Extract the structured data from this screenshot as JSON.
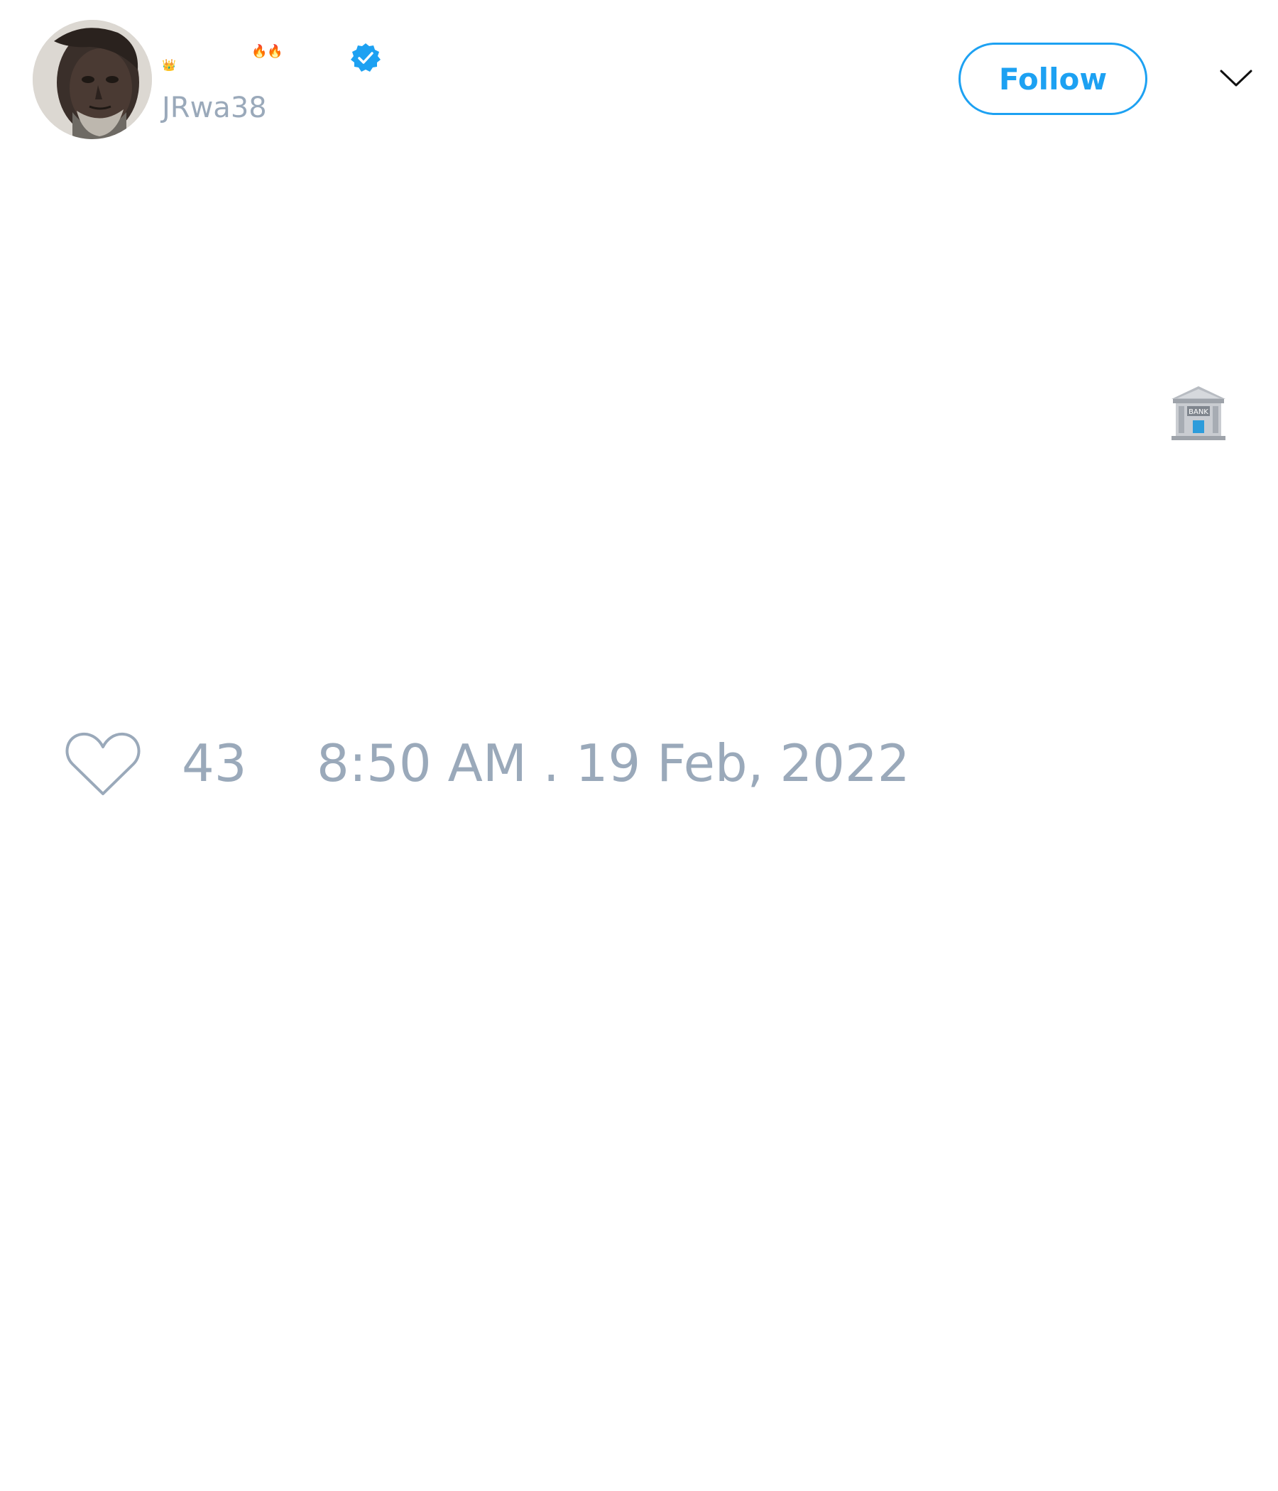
{
  "author": {
    "display_name_emojis": {
      "crown": "👑",
      "fire": "🔥🔥"
    },
    "handle": "JRwa38",
    "verified_icon": "verified-badge-icon",
    "avatar_icon": "avatar-portrait"
  },
  "actions": {
    "follow_label": "Follow",
    "menu_icon": "chevron-down-icon"
  },
  "tweet": {
    "body_emoji_icon": "bank-building-icon"
  },
  "footer": {
    "like_icon": "heart-outline-icon",
    "like_count": "43",
    "timestamp": "8:50 AM . 19 Feb, 2022"
  },
  "colors": {
    "accent": "#1da1f2",
    "muted_text": "#9aa9ba",
    "background": "#ffffff"
  }
}
